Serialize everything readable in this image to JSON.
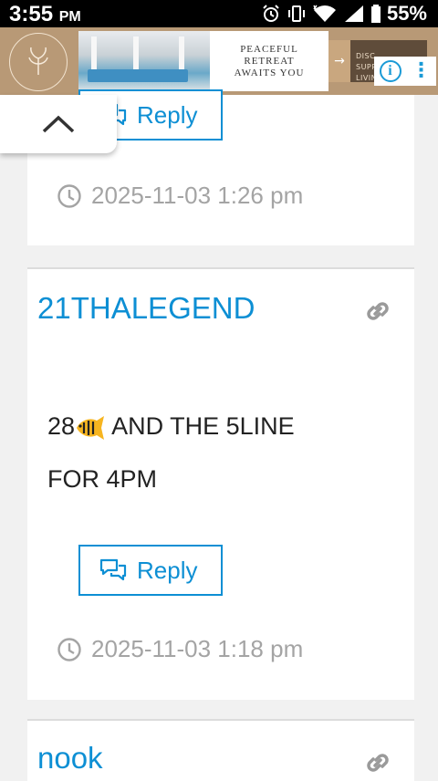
{
  "status_bar": {
    "time": "3:55",
    "ampm": "PM",
    "battery": "55%",
    "icons": [
      "alarm-icon",
      "vibrate-icon",
      "wifi-icon",
      "signal-icon",
      "battery-icon"
    ]
  },
  "ad": {
    "headline_line1": "PEACEFUL",
    "headline_line2": "RETREAT",
    "headline_line3": "AWAITS YOU",
    "cta_line1": "DISC",
    "cta_line2": "SUPREME LIVING",
    "arrow": "→",
    "info_icon": "i",
    "menu_icon": "⋮"
  },
  "comments": [
    {
      "reply_label": "Reply",
      "timestamp": "2025-11-03 1:26 pm"
    },
    {
      "author": "21THALEGEND",
      "text_line1_a": "28",
      "text_line1_b": "AND THE 5LINE",
      "text_line2": "FOR 4PM",
      "reply_label": "Reply",
      "timestamp": "2025-11-03 1:18 pm"
    },
    {
      "author": "nook"
    }
  ],
  "colors": {
    "accent": "#0d8fd4",
    "meta_gray": "#a4a4a4",
    "page_bg": "#f1f1f1"
  }
}
